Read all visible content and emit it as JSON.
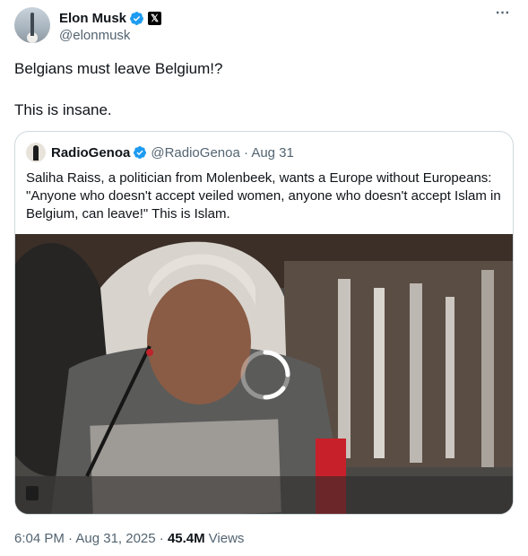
{
  "author": {
    "display_name": "Elon Musk",
    "handle": "@elonmusk",
    "verified_icon": "verified-badge-icon",
    "affiliation_icon": "x-logo-icon",
    "affiliation_glyph": "𝕏"
  },
  "more_icon": "⋯",
  "tweet": {
    "line1": "Belgians must leave Belgium!?",
    "line2": "This is insane."
  },
  "quote": {
    "display_name": "RadioGenoa",
    "handle_date": "@RadioGenoa · Aug 31",
    "text": "Saliha Raiss, a politician from Molenbeek, wants a Europe without Europeans: \"Anyone who doesn't accept veiled women, anyone who doesn't accept Islam in Belgium, can leave!\" This is Islam."
  },
  "footer": {
    "time_date": "6:04 PM · Aug 31, 2025 · ",
    "views_count": "45.4M",
    "views_label": "Views"
  },
  "colors": {
    "verified_blue": "#1d9bf0",
    "secondary_text": "#536471",
    "border": "#cfd9de"
  }
}
